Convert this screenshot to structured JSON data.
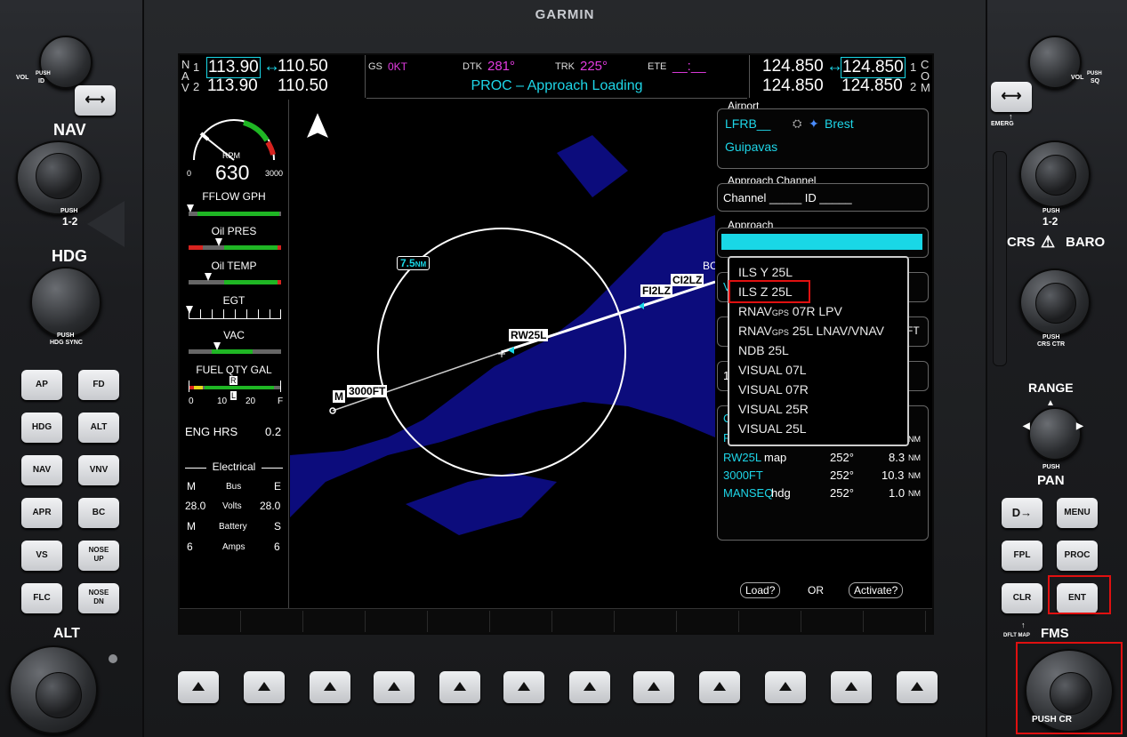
{
  "brand": "GARMIN",
  "nav": {
    "label_n": "N",
    "label_a": "A",
    "label_v": "V",
    "idx1": "1",
    "idx2": "2",
    "nav1_active": "113.90",
    "nav1_standby": "110.50",
    "nav2_active": "113.90",
    "nav2_standby": "110.50",
    "swap_glyph": "↔"
  },
  "com": {
    "label_c": "C",
    "label_o": "O",
    "label_m": "M",
    "idx1": "1",
    "idx2": "2",
    "com1_standby": "124.850",
    "com1_active": "124.850",
    "com2_standby": "124.850",
    "com2_active": "124.850",
    "swap_glyph": "↔"
  },
  "status": {
    "gs_label": "GS",
    "gs_value": "0KT",
    "dtk_label": "DTK",
    "dtk_value": "281°",
    "trk_label": "TRK",
    "trk_value": "225°",
    "ete_label": "ETE",
    "ete_value": "__:__",
    "message": "PROC – Approach Loading"
  },
  "engine": {
    "rpm_label": "RPM",
    "rpm_value": "630",
    "rpm_min": "0",
    "rpm_max": "3000",
    "fflow_label": "FFLOW GPH",
    "oil_pres_label": "Oil PRES",
    "oil_temp_label": "Oil TEMP",
    "egt_label": "EGT",
    "vac_label": "VAC",
    "fuel_label": "FUEL QTY GAL",
    "fuel_ticks": [
      "0",
      "10",
      "20",
      "F"
    ],
    "fuel_r": "R",
    "fuel_l": "L",
    "eng_hrs_label": "ENG HRS",
    "eng_hrs_value": "0.2",
    "electrical_title": "Electrical",
    "m1": "M",
    "bus_label": "Bus",
    "e1": "E",
    "volts_left": "28.0",
    "volts_label": "Volts",
    "volts_right": "28.0",
    "m2": "M",
    "battery_label": "Battery",
    "s1": "S",
    "amps_left": "6",
    "amps_label": "Amps",
    "amps_right": "6"
  },
  "map": {
    "north": "N",
    "range_ring": "7.5",
    "range_unit": "NM",
    "waypoints": {
      "rw25l": "RW25L",
      "fi2lz": "FI2LZ",
      "ci2lz": "CI2LZ",
      "bc": "BC",
      "alt3000": "3000FT",
      "m": "M"
    }
  },
  "procpanel": {
    "airport_label": "Airport",
    "airport_ident": "LFRB__",
    "airport_city": "Brest",
    "airport_name": "Guipavas",
    "channel_label": "Approach Channel",
    "channel_text": "Channel _____ ID _____",
    "approach_label": "Approach",
    "partial_v": "V",
    "partial_ft": "FT",
    "partial_1": "1",
    "partial_c": "C",
    "partial_f": "F",
    "partial_nm": "NM",
    "legs": [
      {
        "name": "RW25L",
        "suffix": " map",
        "crs": "252°",
        "dist": "8.3",
        "unit": "NM"
      },
      {
        "name": "3000FT",
        "suffix": "",
        "crs": "252°",
        "dist": "10.3",
        "unit": "NM"
      },
      {
        "name": "MANSEQ",
        "suffix": " hdg",
        "crs": "252°",
        "dist": "1.0",
        "unit": "NM"
      }
    ],
    "load_button": "Load?",
    "or_text": "OR",
    "activate_button": "Activate?"
  },
  "approach_list": [
    "ILS Y 25L",
    "ILS Z 25L",
    "RNAVGPS 07R LPV",
    "RNAVGPS 25L LNAV/VNAV",
    "NDB 25L",
    "VISUAL 07L",
    "VISUAL 07R",
    "VISUAL 25R",
    "VISUAL 25L"
  ],
  "approach_list_display": {
    "rnav_prefix": "RNAV",
    "gps_sub": "GPS",
    "item2_rest": " 07R LPV",
    "item3_rest": " 25L LNAV/VNAV"
  },
  "panel_left": {
    "vol_label": "VOL",
    "vol_push": "PUSH",
    "vol_id": "ID",
    "nav_title": "NAV",
    "nav_push": "PUSH",
    "nav_12": "1-2",
    "hdg_title": "HDG",
    "hdg_push": "PUSH",
    "hdg_sync": "HDG SYNC",
    "alt_title": "ALT",
    "buttons": [
      "AP",
      "FD",
      "HDG",
      "ALT",
      "NAV",
      "VNV",
      "APR",
      "BC",
      "VS",
      "FLC"
    ],
    "nose_up_top": "NOSE",
    "nose_up_bot": "UP",
    "nose_dn_top": "NOSE",
    "nose_dn_bot": "DN"
  },
  "panel_right": {
    "vol_label": "VOL",
    "vol_push": "PUSH",
    "vol_sq": "SQ",
    "emerg": "EMERG",
    "push": "PUSH",
    "push_12": "1-2",
    "crs": "CRS",
    "baro": "BARO",
    "crs_push": "PUSH",
    "crs_ctr": "CRS CTR",
    "range": "RANGE",
    "pan_push": "PUSH",
    "pan": "PAN",
    "direct_glyph": "D→",
    "menu": "MENU",
    "fpl": "FPL",
    "proc": "PROC",
    "clr": "CLR",
    "ent": "ENT",
    "dflt_map": "DFLT MAP",
    "fms": "FMS",
    "push_cr": "PUSH CR"
  }
}
